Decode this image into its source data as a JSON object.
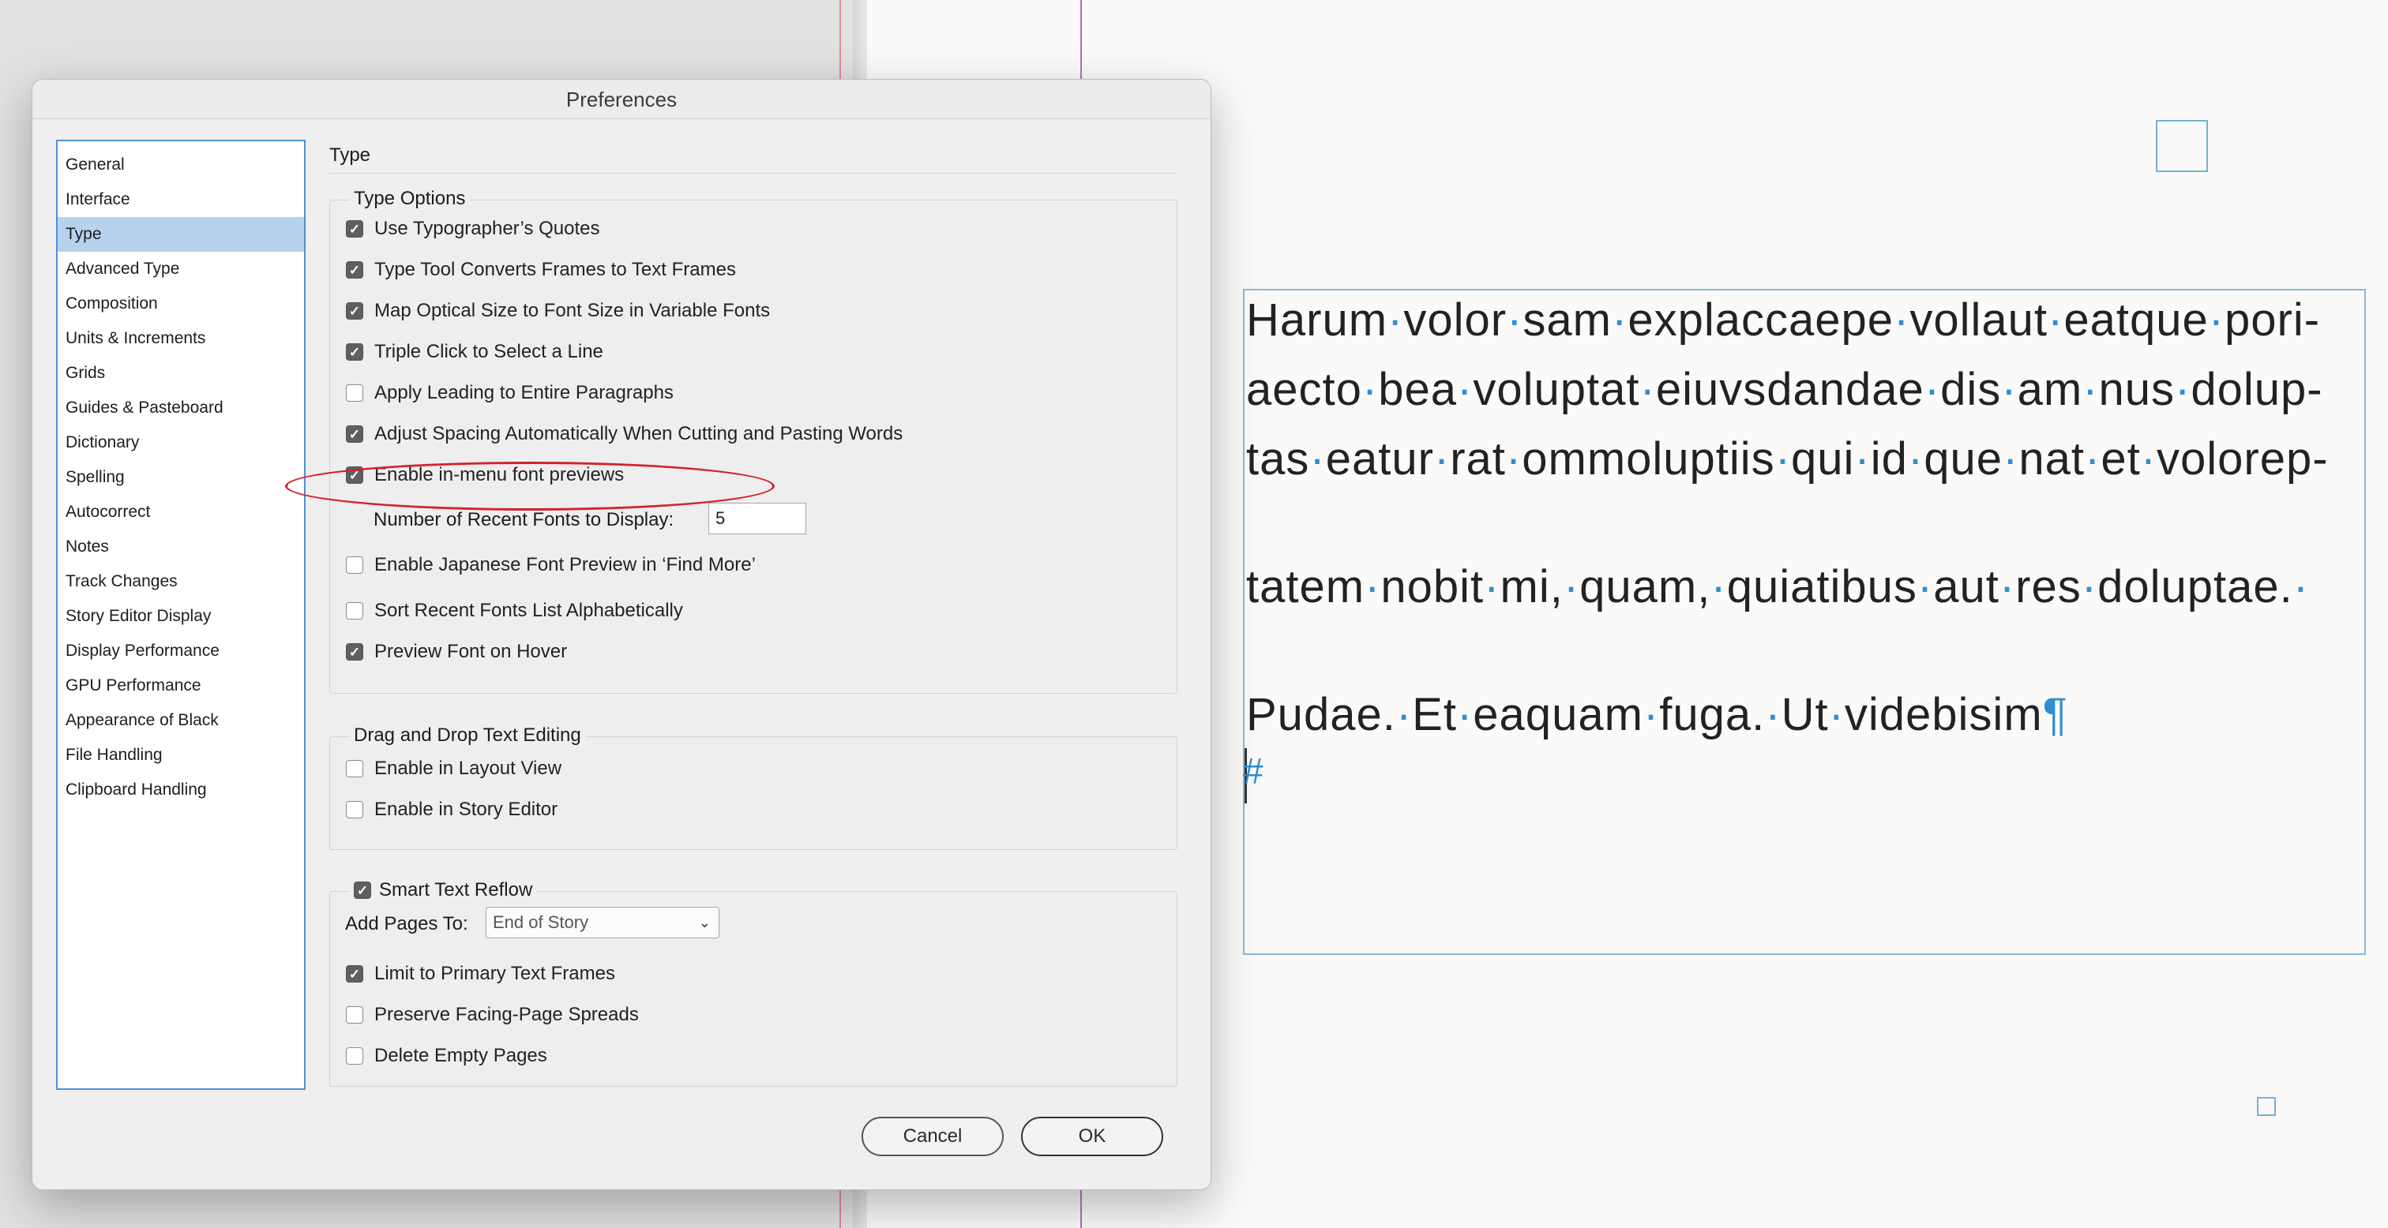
{
  "dialog": {
    "title": "Preferences",
    "section_heading": "Type",
    "categories": [
      {
        "label": "General",
        "selected": false
      },
      {
        "label": "Interface",
        "selected": false
      },
      {
        "label": "Type",
        "selected": true
      },
      {
        "label": "Advanced Type",
        "selected": false
      },
      {
        "label": "Composition",
        "selected": false
      },
      {
        "label": "Units & Increments",
        "selected": false
      },
      {
        "label": "Grids",
        "selected": false
      },
      {
        "label": "Guides & Pasteboard",
        "selected": false
      },
      {
        "label": "Dictionary",
        "selected": false
      },
      {
        "label": "Spelling",
        "selected": false
      },
      {
        "label": "Autocorrect",
        "selected": false
      },
      {
        "label": "Notes",
        "selected": false
      },
      {
        "label": "Track Changes",
        "selected": false
      },
      {
        "label": "Story Editor Display",
        "selected": false
      },
      {
        "label": "Display Performance",
        "selected": false
      },
      {
        "label": "GPU Performance",
        "selected": false
      },
      {
        "label": "Appearance of Black",
        "selected": false
      },
      {
        "label": "File Handling",
        "selected": false
      },
      {
        "label": "Clipboard Handling",
        "selected": false
      }
    ],
    "type_options": {
      "title": "Type Options",
      "options": [
        {
          "label": "Use Typographer’s Quotes",
          "checked": true
        },
        {
          "label": "Type Tool Converts Frames to Text Frames",
          "checked": true
        },
        {
          "label": "Map Optical Size to Font Size in Variable Fonts",
          "checked": true
        },
        {
          "label": "Triple Click to Select a Line",
          "checked": true
        },
        {
          "label": "Apply Leading to Entire Paragraphs",
          "checked": false
        },
        {
          "label": "Adjust Spacing Automatically When Cutting and Pasting Words",
          "checked": true
        },
        {
          "label": "Enable in-menu font previews",
          "checked": true
        }
      ],
      "recent_fonts_label": "Number of Recent Fonts to Display:",
      "recent_fonts_value": "5",
      "options_after": [
        {
          "label": "Enable Japanese Font Preview in ‘Find More’",
          "checked": false
        },
        {
          "label": "Sort Recent Fonts List Alphabetically",
          "checked": false
        },
        {
          "label": "Preview Font on Hover",
          "checked": true
        }
      ]
    },
    "drag_drop": {
      "title": "Drag and Drop Text Editing",
      "options": [
        {
          "label": "Enable in Layout View",
          "checked": false
        },
        {
          "label": "Enable in Story Editor",
          "checked": false
        }
      ]
    },
    "smart_reflow": {
      "title": "Smart Text Reflow",
      "checked": true,
      "add_pages_label": "Add Pages To:",
      "add_pages_value": "End of Story",
      "options": [
        {
          "label": "Limit to Primary Text Frames",
          "checked": true
        },
        {
          "label": "Preserve Facing-Page Spreads",
          "checked": false
        },
        {
          "label": "Delete Empty Pages",
          "checked": false
        }
      ]
    },
    "cancel_label": "Cancel",
    "ok_label": "OK"
  },
  "document": {
    "lines": [
      "Harum·volor·sam·explaccaepe·vollaut·eatque·pori-",
      "aecto·bea·voluptat·eiuvsdandae·dis·am·nus·dolup-",
      "tas·eatur·rat·ommoluptiis·qui·id·que·nat·et·volorep-",
      "tatem·nobit·mi,·quam,·quiatibus·aut·res·doluptae.·",
      "Pudae.·Et·eaquam·fuga.·Ut·videbisim"
    ],
    "pilcrow": "¶",
    "end_mark": "#"
  },
  "colors": {
    "highlight": "#d3222b",
    "selection": "#b7d2ef",
    "frame": "#86bad9",
    "hidden_chars": "#2d8ed0"
  }
}
